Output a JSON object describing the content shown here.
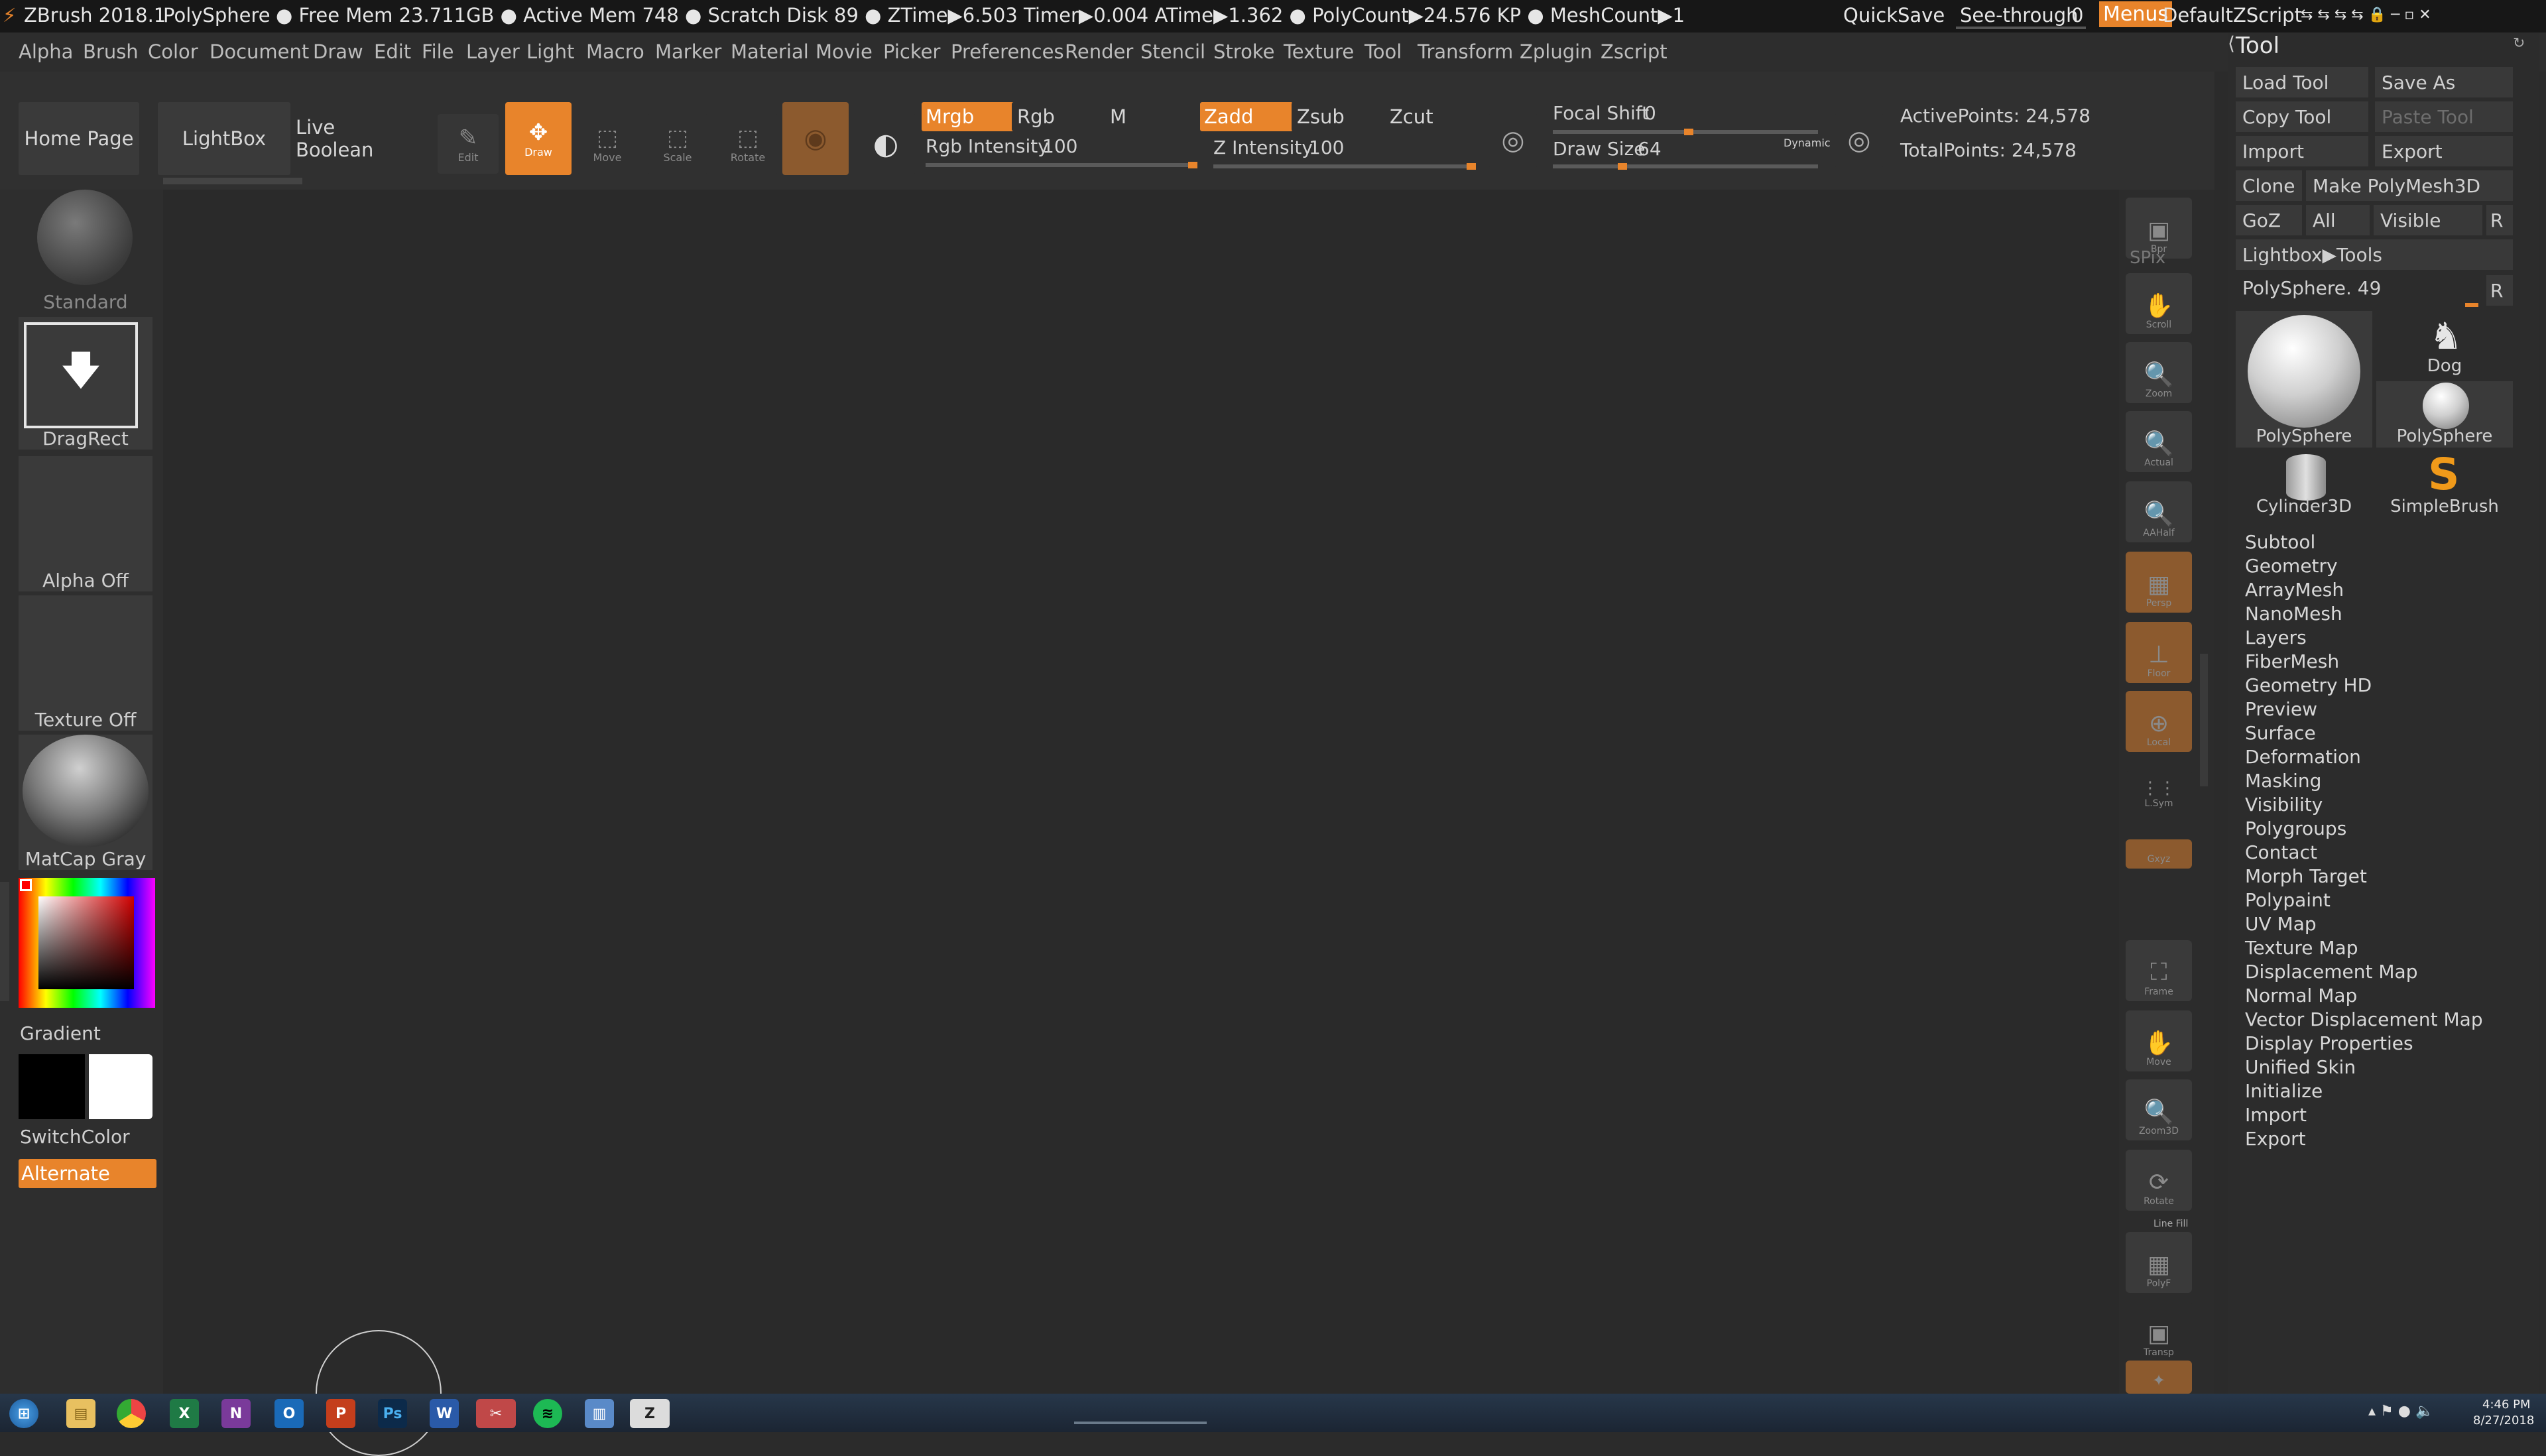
{
  "titlebar": {
    "app": "ZBrush 2018.1",
    "tool": "PolySphere",
    "stats": "● Free Mem 23.711GB ● Active Mem 748 ● Scratch Disk 89 ●  ZTime▶6.503 Timer▶0.004 ATime▶1.362 ● PolyCount▶24.576 KP  ● MeshCount▶1",
    "quicksave": "QuickSave",
    "seethrough_label": "See-through",
    "seethrough_value": "0",
    "menus": "Menus",
    "script": "DefaultZScript"
  },
  "menus": [
    "Alpha",
    "Brush",
    "Color",
    "Document",
    "Draw",
    "Edit",
    "File",
    "Layer",
    "Light",
    "Macro",
    "Marker",
    "Material",
    "Movie",
    "Picker",
    "Preferences",
    "Render",
    "Stencil",
    "Stroke",
    "Texture",
    "Tool",
    "Transform",
    "Zplugin",
    "Zscript"
  ],
  "shelf": {
    "home": "Home Page",
    "lightbox": "LightBox",
    "liveboolean": "Live Boolean",
    "edit": "Edit",
    "draw": "Draw",
    "move": "Move",
    "scale": "Scale",
    "rotate": "Rotate",
    "mrgb": "Mrgb",
    "rgb": "Rgb",
    "m": "M",
    "rgb_intensity_label": "Rgb Intensity",
    "rgb_intensity_value": "100",
    "zadd": "Zadd",
    "zsub": "Zsub",
    "zcut": "Zcut",
    "z_intensity_label": "Z Intensity",
    "z_intensity_value": "100",
    "focal_label": "Focal Shift",
    "focal_value": "0",
    "drawsize_label": "Draw Size",
    "drawsize_value": "64",
    "dynamic": "Dynamic",
    "active_points": "ActivePoints: 24,578",
    "total_points": "TotalPoints: 24,578"
  },
  "lefttray": {
    "brush": "Standard",
    "stroke": "DragRect",
    "alpha": "Alpha Off",
    "texture": "Texture Off",
    "material": "MatCap Gray",
    "gradient": "Gradient",
    "switchcolor": "SwitchColor",
    "alternate": "Alternate"
  },
  "rdock": {
    "spix": "SPix",
    "buttons": [
      "Bpr",
      "Scroll",
      "Zoom",
      "Actual",
      "AAHalf",
      "Persp",
      "Floor",
      "Local",
      "L.Sym",
      "Gxyz",
      "Frame",
      "Move",
      "Zoom3D",
      "Rotate",
      "PolyF",
      "Transp",
      "Solo"
    ],
    "linefill": "Line Fill"
  },
  "tool": {
    "title": "Tool",
    "load": "Load Tool",
    "saveas": "Save As",
    "copy": "Copy Tool",
    "paste": "Paste Tool",
    "import": "Import",
    "export": "Export",
    "clone": "Clone",
    "makepm": "Make PolyMesh3D",
    "goz": "GoZ",
    "all": "All",
    "visible": "Visible",
    "r": "R",
    "lightbox_tools": "Lightbox▶Tools",
    "current": "PolySphere. 49",
    "tiles": [
      "PolySphere",
      "Dog",
      "PolySphere",
      "Cylinder3D",
      "SimpleBrush"
    ],
    "subpalettes": [
      "Subtool",
      "Geometry",
      "ArrayMesh",
      "NanoMesh",
      "Layers",
      "FiberMesh",
      "Geometry HD",
      "Preview",
      "Surface",
      "Deformation",
      "Masking",
      "Visibility",
      "Polygroups",
      "Contact",
      "Morph Target",
      "Polypaint",
      "UV Map",
      "Texture Map",
      "Displacement Map",
      "Normal Map",
      "Vector Displacement Map",
      "Display Properties",
      "Unified Skin",
      "Initialize",
      "Import",
      "Export"
    ]
  },
  "taskbar": {
    "time": "4:46 PM",
    "date": "8/27/2018"
  }
}
